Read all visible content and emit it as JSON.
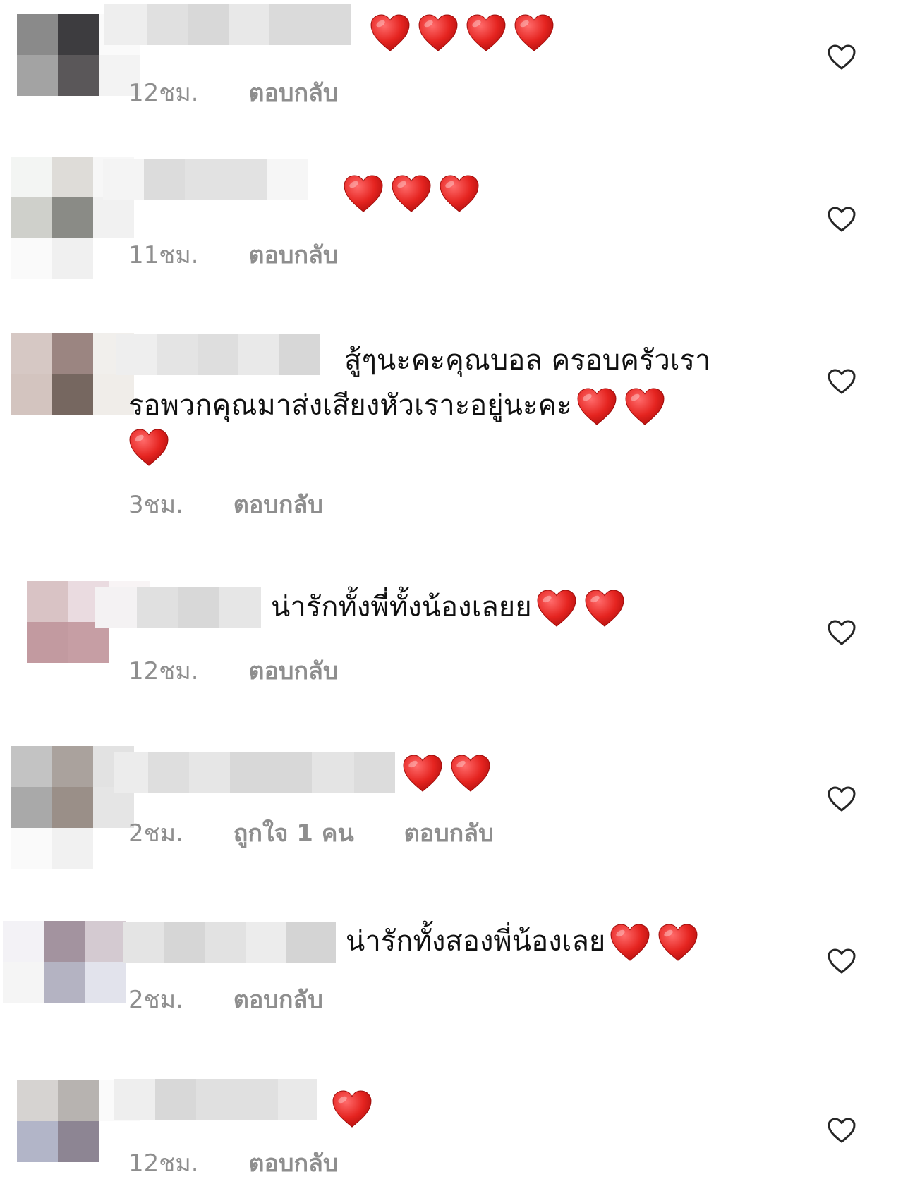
{
  "comments": [
    {
      "text": "",
      "hearts": 4,
      "time": "12ชม.",
      "likes": "",
      "reply": "ตอบกลับ"
    },
    {
      "text": "",
      "hearts": 3,
      "time": "11ชม.",
      "likes": "",
      "reply": "ตอบกลับ"
    },
    {
      "text_line1": "สู้ๆนะคะคุณบอล ครอบครัวเรา",
      "text_line2": "รอพวกคุณมาส่งเสียงหัวเราะอยู่นะคะ",
      "hearts": 3,
      "time": "3ชม.",
      "likes": "",
      "reply": "ตอบกลับ"
    },
    {
      "text": "น่ารักทั้งพี่ทั้งน้องเลยย",
      "hearts": 2,
      "time": "12ชม.",
      "likes": "",
      "reply": "ตอบกลับ"
    },
    {
      "text": "",
      "hearts": 2,
      "time": "2ชม.",
      "likes": "ถูกใจ 1 คน",
      "reply": "ตอบกลับ"
    },
    {
      "text": "น่ารักทั้งสองพี่น้องเลย",
      "hearts": 2,
      "time": "2ชม.",
      "likes": "",
      "reply": "ตอบกลับ"
    },
    {
      "text": "",
      "hearts": 1,
      "time": "12ชม.",
      "likes": "",
      "reply": "ตอบกลับ"
    }
  ],
  "icons": {
    "comment_heart": "red-heart-emoji",
    "like": "heart-outline-icon"
  },
  "colors": {
    "heart_red": "#e0201f",
    "meta_gray": "#8e8e8e",
    "blur_gray": "#d9d9d9"
  }
}
